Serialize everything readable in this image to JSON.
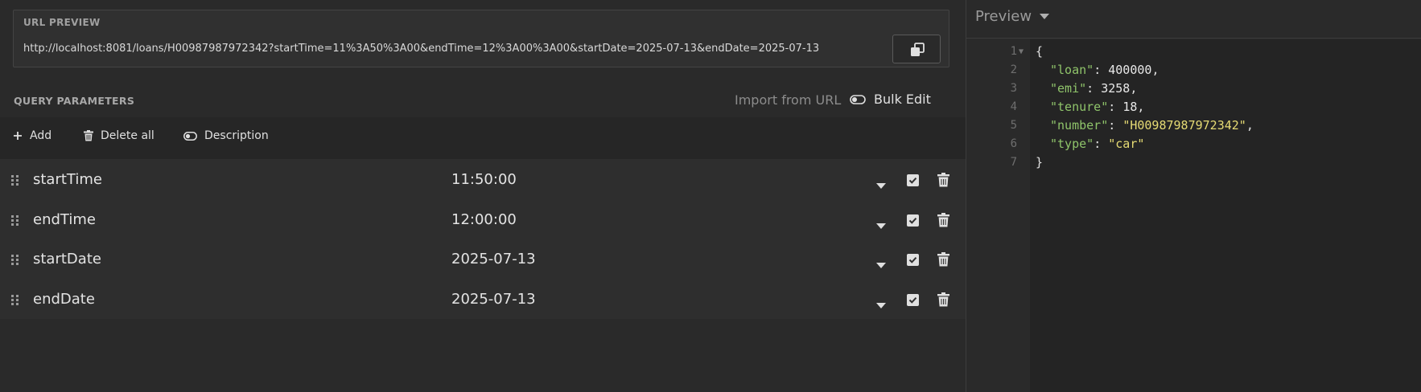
{
  "url_preview": {
    "title": "URL PREVIEW",
    "url": "http://localhost:8081/loans/H00987987972342?startTime=11%3A50%3A00&endTime=12%3A00%3A00&startDate=2025-07-13&endDate=2025-07-13",
    "copy_icon": "copy-icon"
  },
  "query_params": {
    "title": "QUERY PARAMETERS",
    "import_from_url": "Import from URL",
    "bulk_edit": "Bulk Edit",
    "toolbar": {
      "add": "Add",
      "delete_all": "Delete all",
      "description": "Description"
    },
    "rows": [
      {
        "key": "startTime",
        "value": "11:50:00",
        "enabled": true
      },
      {
        "key": "endTime",
        "value": "12:00:00",
        "enabled": true
      },
      {
        "key": "startDate",
        "value": "2025-07-13",
        "enabled": true
      },
      {
        "key": "endDate",
        "value": "2025-07-13",
        "enabled": true
      }
    ]
  },
  "preview": {
    "title": "Preview",
    "lines": [
      {
        "n": "1",
        "text": "{"
      },
      {
        "n": "2",
        "key": "\"loan\"",
        "value": "400000",
        "vtype": "number",
        "trail": ","
      },
      {
        "n": "3",
        "key": "\"emi\"",
        "value": "3258",
        "vtype": "number",
        "trail": ","
      },
      {
        "n": "4",
        "key": "\"tenure\"",
        "value": "18",
        "vtype": "number",
        "trail": ","
      },
      {
        "n": "5",
        "key": "\"number\"",
        "value": "\"H00987987972342\"",
        "vtype": "string",
        "trail": ","
      },
      {
        "n": "6",
        "key": "\"type\"",
        "value": "\"car\"",
        "vtype": "string",
        "trail": ""
      },
      {
        "n": "7",
        "text": "}"
      }
    ]
  },
  "colors": {
    "background": "#2a2a2a",
    "json_key": "#8fc46a",
    "json_string": "#e6db74"
  }
}
